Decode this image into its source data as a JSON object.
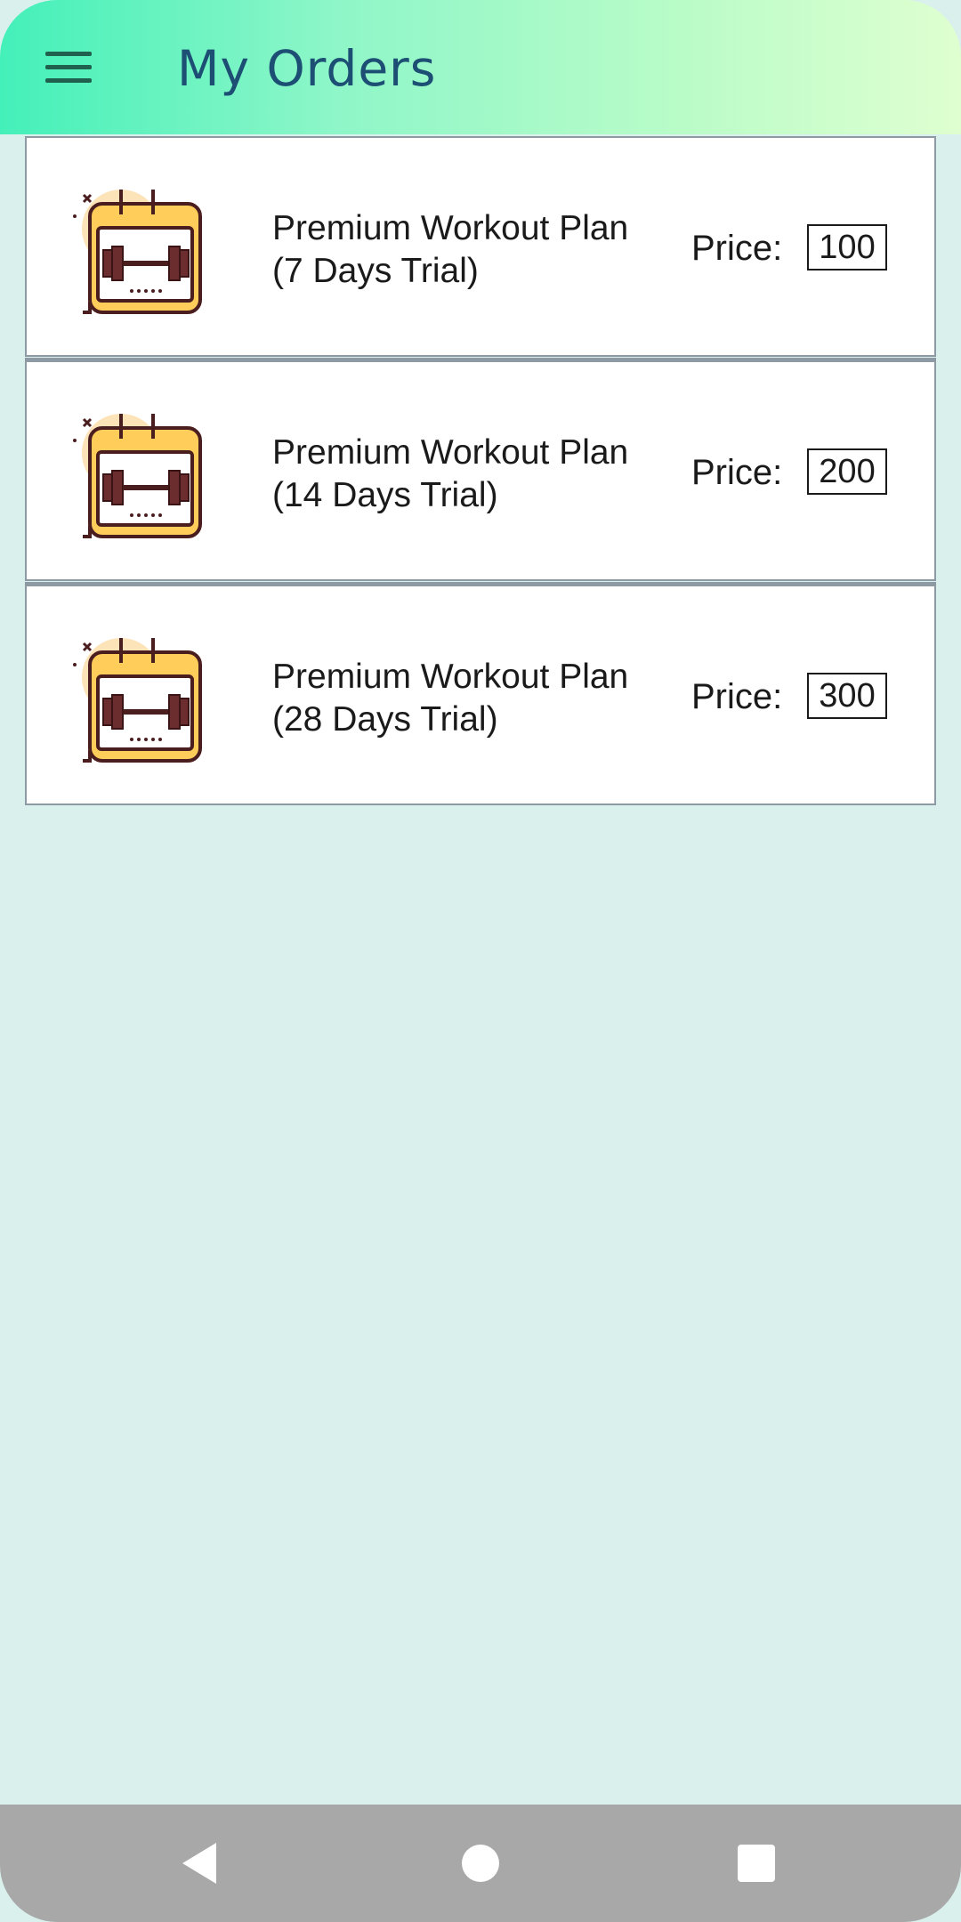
{
  "header": {
    "title": "My Orders",
    "menu_icon": "hamburger-menu-icon"
  },
  "orders": [
    {
      "icon": "workout-calendar-icon",
      "title_line1": "Premium Workout Plan",
      "title_line2": "(7 Days Trial)",
      "price_label": "Price:",
      "price": "100"
    },
    {
      "icon": "workout-calendar-icon",
      "title_line1": "Premium Workout Plan",
      "title_line2": "(14 Days Trial)",
      "price_label": "Price:",
      "price": "200"
    },
    {
      "icon": "workout-calendar-icon",
      "title_line1": "Premium Workout Plan",
      "title_line2": "(28 Days Trial)",
      "price_label": "Price:",
      "price": "300"
    }
  ],
  "navigation": {
    "back_icon": "back-triangle-icon",
    "home_icon": "home-circle-icon",
    "recents_icon": "recents-square-icon"
  },
  "colors": {
    "header_gradient_start": "#44f0b9",
    "header_gradient_end": "#dfffd0",
    "title": "#1d4e73",
    "background": "#daf0ec",
    "nav_bar": "#a8a8a8"
  }
}
